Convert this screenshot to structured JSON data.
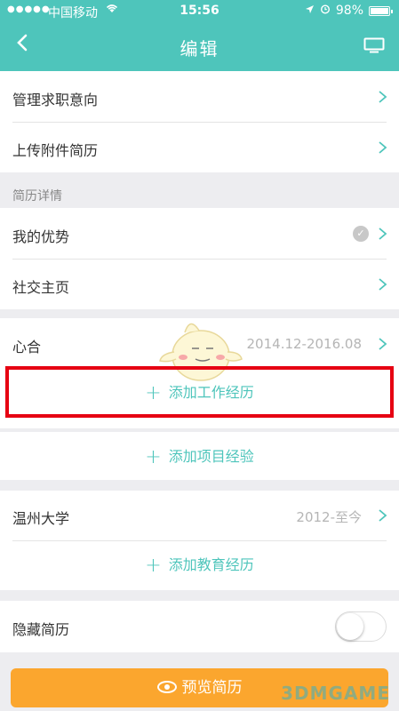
{
  "status_bar": {
    "signal_dots": "●●●●●",
    "carrier": "中国移动",
    "time": "15:56",
    "battery": "98%",
    "battery_level": 0.98
  },
  "nav": {
    "title": "编辑",
    "back_icon": "chevron-left-icon",
    "screen_icon": "monitor-icon"
  },
  "rows": {
    "manage_intent": "管理求职意向",
    "upload_resume": "上传附件简历",
    "details_section": "简历详情",
    "my_strengths": "我的优势",
    "social_page": "社交主页"
  },
  "work": {
    "company": "心合",
    "dates": "2014.12-2016.08",
    "add_label": "添加工作经历"
  },
  "project": {
    "add_label": "添加项目经验"
  },
  "education": {
    "school": "温州大学",
    "dates": "2012-至今",
    "add_label": "添加教育经历"
  },
  "privacy": {
    "hide_label": "隐藏简历",
    "hidden": false
  },
  "footer": {
    "preview_label": "预览简历"
  },
  "watermark": "3DMGAME",
  "colors": {
    "accent": "#4ec5bb",
    "orange": "#fba62e",
    "highlight": "#e60012"
  }
}
